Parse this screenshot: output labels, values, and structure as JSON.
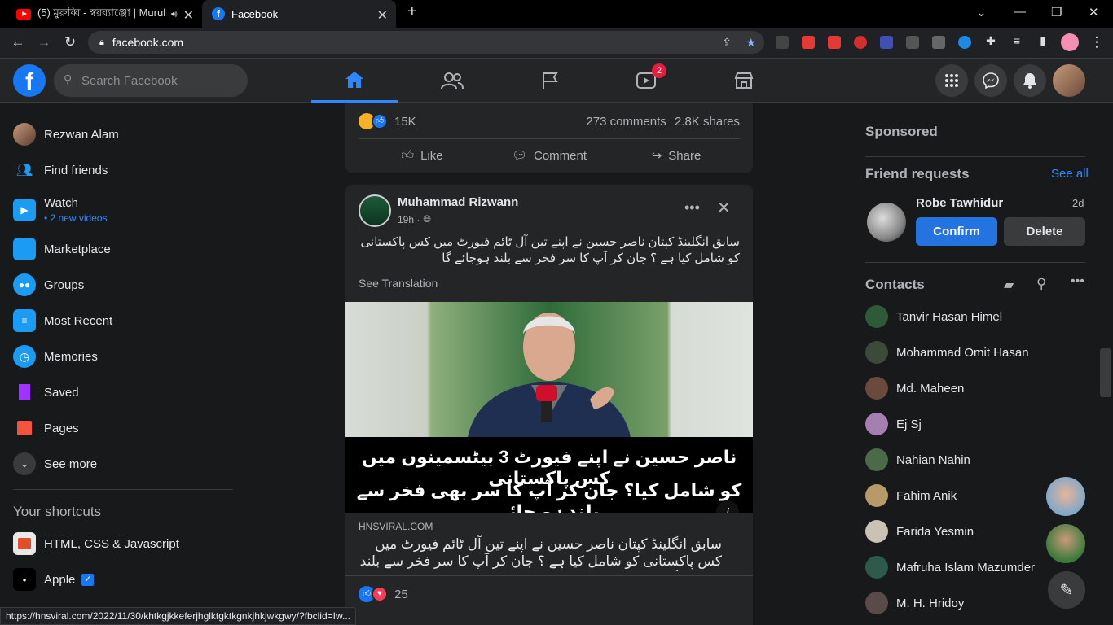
{
  "browser": {
    "tabs": [
      {
        "title": "(5) মুরুব্বি - স্বরব্যাঞ্জো | Murul"
      },
      {
        "title": "Facebook"
      }
    ],
    "url": "facebook.com",
    "status_url": "https://hnsviral.com/2022/11/30/khtkgjkkeferjhglktgktkgnkjhkjwkgwy/?fbclid=Iw..."
  },
  "header": {
    "search_placeholder": "Search Facebook",
    "watch_badge": "2"
  },
  "sidebar": {
    "items": [
      {
        "label": "Rezwan Alam"
      },
      {
        "label": "Find friends"
      },
      {
        "label": "Watch",
        "sub": "• 2 new videos"
      },
      {
        "label": "Marketplace"
      },
      {
        "label": "Groups"
      },
      {
        "label": "Most Recent"
      },
      {
        "label": "Memories"
      },
      {
        "label": "Saved"
      },
      {
        "label": "Pages"
      },
      {
        "label": "See more"
      }
    ],
    "shortcuts_heading": "Your shortcuts",
    "shortcuts": [
      {
        "label": "HTML, CSS & Javascript"
      },
      {
        "label": "Apple"
      }
    ]
  },
  "feed": {
    "prev_post": {
      "reactions_count": "15K",
      "comments": "273 comments",
      "shares": "2.8K shares",
      "like": "Like",
      "comment": "Comment",
      "share": "Share"
    },
    "post": {
      "author": "Muhammad Rizwann",
      "time": "19h ·",
      "text": "سابق انگلینڈ کپتان ناصر حسین نے اپنے تین آل ٹائم فیورٹ میں کس پاکستانی کو شامل کیا ہے ؟ جان کر آپ کا سر فخر سے بلند ہوجائے گا",
      "see_translation": "See Translation",
      "image_caption_line1": "ناصر حسین نے اپنے فیورٹ 3 بیٹسمینوں میں کس پاکستانی",
      "image_caption_line2": "کو شامل کیا؟ جان کر آپ کا سر بھی فخر سے بلند ہو جائے",
      "link_domain": "HNSVIRAL.COM",
      "link_title": "سابق انگلینڈ کپتان ناصر حسین نے اپنے تین آل ٹائم فیورٹ میں کس پاکستانی کو شامل کیا ہے ؟ جان کر آپ کا سر فخر سے بلند ہوجائے گا",
      "reactions_count": "25"
    }
  },
  "right": {
    "sponsored": "Sponsored",
    "friend_requests": "Friend requests",
    "see_all": "See all",
    "request": {
      "name": "Robe Tawhidur",
      "age": "2d",
      "confirm": "Confirm",
      "delete": "Delete"
    },
    "contacts_heading": "Contacts",
    "contacts": [
      {
        "name": "Tanvir Hasan Himel"
      },
      {
        "name": "Mohammad Omit Hasan"
      },
      {
        "name": "Md. Maheen"
      },
      {
        "name": "Ej Sj"
      },
      {
        "name": "Nahian Nahin"
      },
      {
        "name": "Fahim Anik"
      },
      {
        "name": "Farida Yesmin"
      },
      {
        "name": "Mafruha Islam Mazumder"
      },
      {
        "name": "M. H. Hridoy"
      }
    ]
  },
  "colors": {
    "accent": "#2d88ff",
    "fb_blue": "#1877f2",
    "bg": "#18191a",
    "card": "#242526"
  }
}
